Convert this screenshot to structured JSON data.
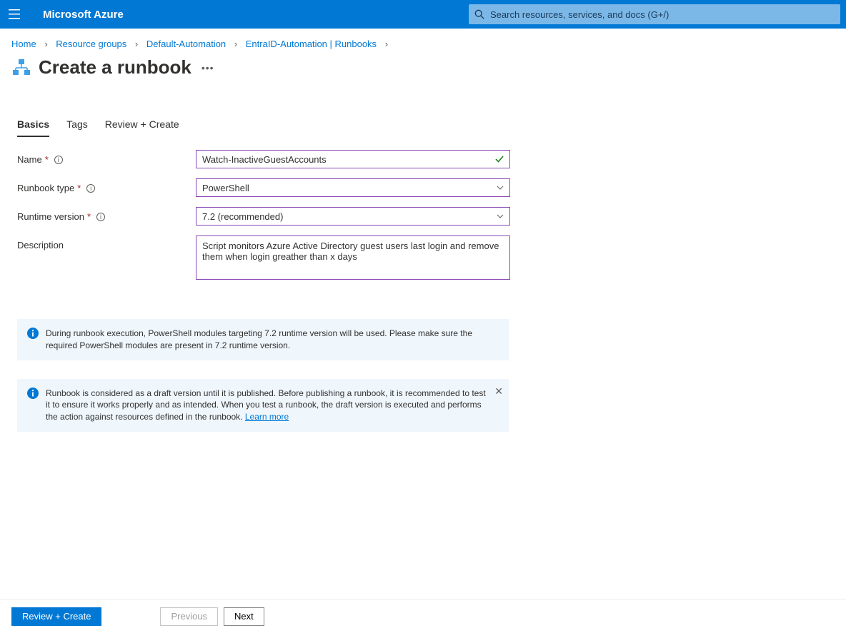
{
  "topbar": {
    "brand": "Microsoft Azure",
    "search_placeholder": "Search resources, services, and docs (G+/)"
  },
  "breadcrumb": {
    "items": [
      {
        "label": "Home"
      },
      {
        "label": "Resource groups"
      },
      {
        "label": "Default-Automation"
      },
      {
        "label": "EntraID-Automation | Runbooks"
      }
    ]
  },
  "page": {
    "title": "Create a runbook"
  },
  "tabs": [
    {
      "label": "Basics",
      "active": true
    },
    {
      "label": "Tags",
      "active": false
    },
    {
      "label": "Review + Create",
      "active": false
    }
  ],
  "form": {
    "name_label": "Name",
    "name_value": "Watch-InactiveGuestAccounts",
    "type_label": "Runbook type",
    "type_value": "PowerShell",
    "runtime_label": "Runtime version",
    "runtime_value": "7.2 (recommended)",
    "description_label": "Description",
    "description_value": "Script monitors Azure Active Directory guest users last login and remove them when login greather than x days"
  },
  "banners": {
    "runtime_info": "During runbook execution, PowerShell modules targeting 7.2 runtime version will be used. Please make sure the required PowerShell modules are present in 7.2 runtime version.",
    "draft_info": "Runbook is considered as a draft version until it is published. Before publishing a runbook, it is recommended to test it to ensure it works properly and as intended. When you test a runbook, the draft version is executed and performs the action against resources defined in the runbook. ",
    "learn_more": "Learn more"
  },
  "footer": {
    "review_create": "Review + Create",
    "previous": "Previous",
    "next": "Next"
  }
}
